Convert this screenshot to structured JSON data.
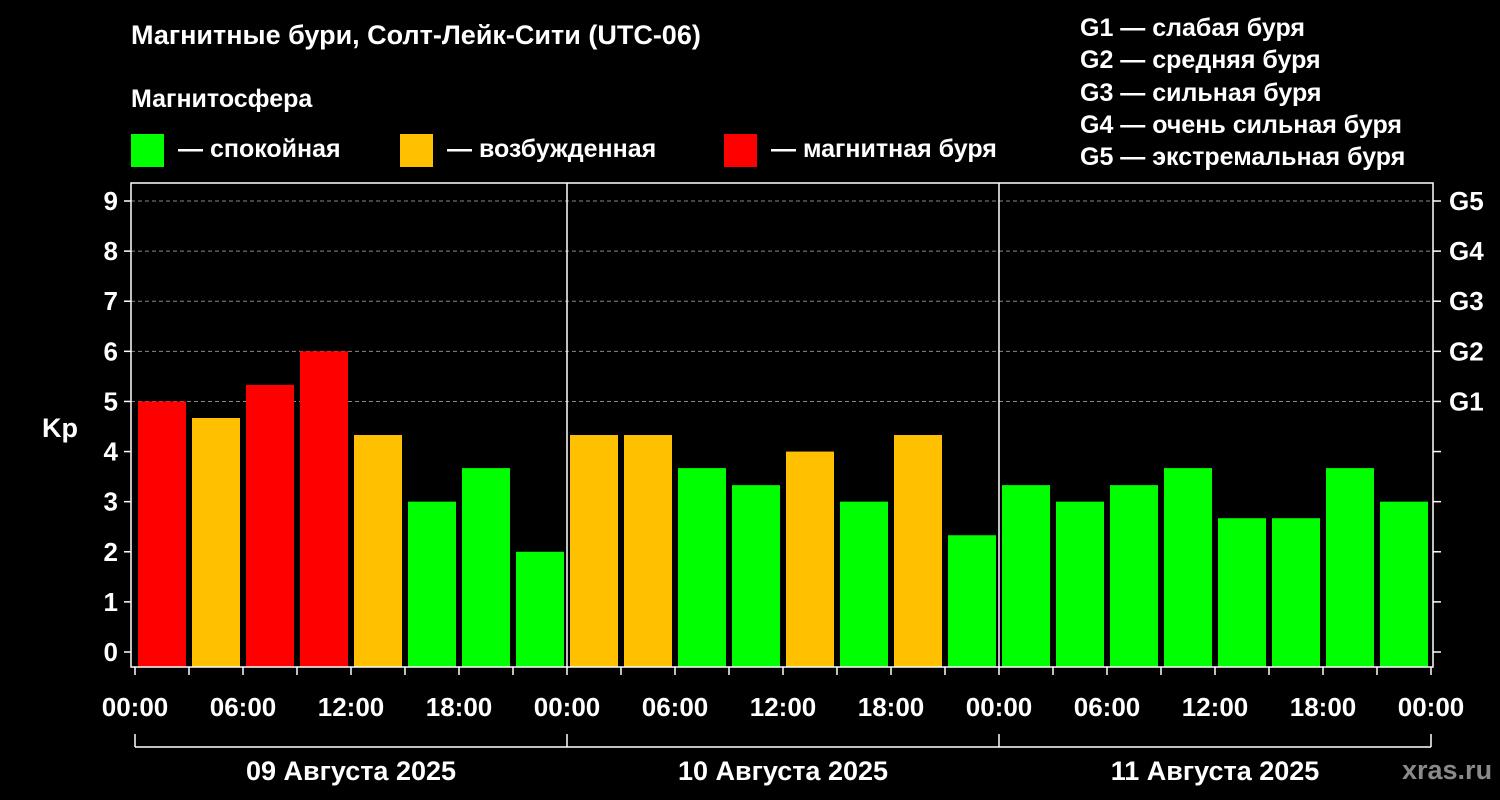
{
  "header": {
    "title": "Магнитные бури, Солт-Лейк-Сити (UTC-06)",
    "subtitle": "Магнитосфера"
  },
  "legend": [
    {
      "label": "— спокойная",
      "color": "#00ff00"
    },
    {
      "label": "— возбужденная",
      "color": "#ffc000"
    },
    {
      "label": "— магнитная буря",
      "color": "#ff0000"
    }
  ],
  "g_scale": [
    "G1 — слабая буря",
    "G2 — средняя буря",
    "G3 — сильная буря",
    "G4 — очень сильная буря",
    "G5 — экстремальная буря"
  ],
  "watermark": "xras.ru",
  "chart_data": {
    "type": "bar",
    "ylabel": "Kp",
    "ylim": [
      0,
      9
    ],
    "yticks": [
      "0",
      "1",
      "2",
      "3",
      "4",
      "5",
      "6",
      "7",
      "8",
      "9"
    ],
    "right_ticks": [
      {
        "value": 5,
        "label": "G1"
      },
      {
        "value": 6,
        "label": "G2"
      },
      {
        "value": 7,
        "label": "G3"
      },
      {
        "value": 8,
        "label": "G4"
      },
      {
        "value": 9,
        "label": "G5"
      }
    ],
    "grid": "horizontal dashed",
    "xtick_labels": [
      "00:00",
      "06:00",
      "12:00",
      "18:00",
      "00:00",
      "06:00",
      "12:00",
      "18:00",
      "00:00",
      "06:00",
      "12:00",
      "18:00",
      "00:00"
    ],
    "dates": [
      "09 Августа 2025",
      "10 Августа 2025",
      "11 Августа 2025"
    ],
    "interval_hours": 3,
    "categories": [
      "09 Августа 2025 00:00",
      "09 Августа 2025 03:00",
      "09 Августа 2025 06:00",
      "09 Августа 2025 09:00",
      "09 Августа 2025 12:00",
      "09 Августа 2025 15:00",
      "09 Августа 2025 18:00",
      "09 Августа 2025 21:00",
      "10 Августа 2025 00:00",
      "10 Августа 2025 03:00",
      "10 Августа 2025 06:00",
      "10 Августа 2025 09:00",
      "10 Августа 2025 12:00",
      "10 Августа 2025 15:00",
      "10 Августа 2025 18:00",
      "10 Августа 2025 21:00",
      "11 Августа 2025 00:00",
      "11 Августа 2025 03:00",
      "11 Августа 2025 06:00",
      "11 Августа 2025 09:00",
      "11 Августа 2025 12:00",
      "11 Августа 2025 15:00",
      "11 Августа 2025 18:00",
      "11 Августа 2025 21:00"
    ],
    "values": [
      5.0,
      4.67,
      5.33,
      6.0,
      4.33,
      3.0,
      3.67,
      2.0,
      4.33,
      4.33,
      3.67,
      3.33,
      4.0,
      3.0,
      4.33,
      2.33,
      3.33,
      3.0,
      3.33,
      3.67,
      2.67,
      2.67,
      3.67,
      3.0
    ],
    "colors": [
      "#ff0000",
      "#ffc000",
      "#ff0000",
      "#ff0000",
      "#ffc000",
      "#00ff00",
      "#00ff00",
      "#00ff00",
      "#ffc000",
      "#ffc000",
      "#00ff00",
      "#00ff00",
      "#ffc000",
      "#00ff00",
      "#ffc000",
      "#00ff00",
      "#00ff00",
      "#00ff00",
      "#00ff00",
      "#00ff00",
      "#00ff00",
      "#00ff00",
      "#00ff00",
      "#00ff00"
    ]
  }
}
